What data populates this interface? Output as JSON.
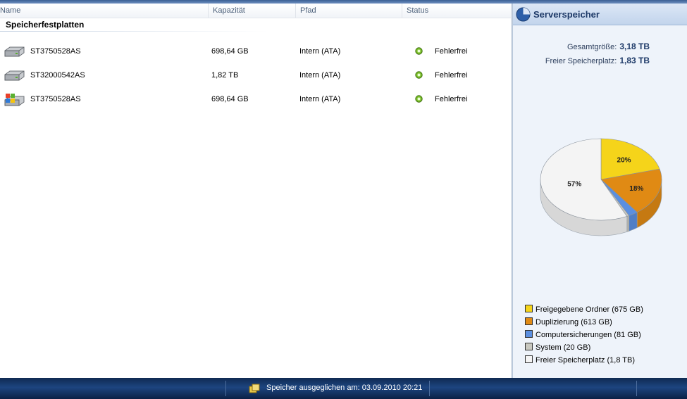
{
  "columns": {
    "name": "Name",
    "capacity": "Kapazität",
    "path": "Pfad",
    "status": "Status"
  },
  "group": "Speicherfestplatten",
  "drives": [
    {
      "name": "ST3750528AS",
      "capacity": "698,64 GB",
      "path": "Intern (ATA)",
      "status": "Fehlerfrei",
      "icon": "hard-drive-icon"
    },
    {
      "name": "ST32000542AS",
      "capacity": "1,82 TB",
      "path": "Intern (ATA)",
      "status": "Fehlerfrei",
      "icon": "hard-drive-icon"
    },
    {
      "name": "ST3750528AS",
      "capacity": "698,64 GB",
      "path": "Intern (ATA)",
      "status": "Fehlerfrei",
      "icon": "system-drive-icon"
    }
  ],
  "panel": {
    "title": "Serverspeicher",
    "total_label": "Gesamtgröße:",
    "total_value": "3,18 TB",
    "free_label": "Freier Speicherplatz:",
    "free_value": "1,83 TB"
  },
  "chart_data": {
    "type": "pie",
    "slices": [
      {
        "name": "Freigegebene Ordner (675 GB)",
        "value": 675,
        "label": "20%",
        "color": "#f5d41a"
      },
      {
        "name": "Duplizierung (613 GB)",
        "value": 613,
        "label": "18%",
        "color": "#e08a14"
      },
      {
        "name": "Computersicherungen (81 GB)",
        "value": 81,
        "label": "",
        "color": "#5b8fe0"
      },
      {
        "name": "System (20 GB)",
        "value": 20,
        "label": "",
        "color": "#c8c8c0"
      },
      {
        "name": "Freier Speicherplatz (1,8 TB)",
        "value": 1843,
        "label": "57%",
        "color": "#f4f4f4"
      }
    ]
  },
  "statusbar": {
    "message": "Speicher ausgeglichen am: 03.09.2010 20:21"
  },
  "colors": {
    "ok": "#7bbf2a",
    "accent": "#1e3a68"
  }
}
